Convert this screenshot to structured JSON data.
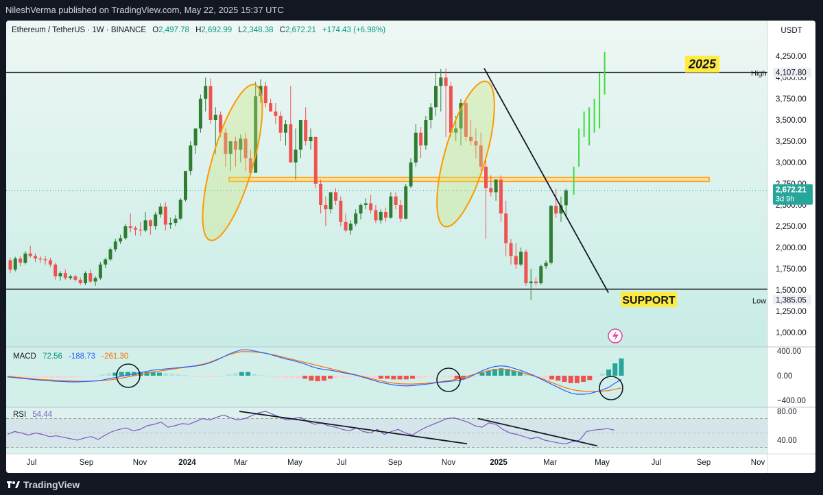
{
  "header": {
    "published": "NileshVerma published on TradingView.com, May 22, 2025 15:37 UTC"
  },
  "footer": {
    "brand": "TradingView"
  },
  "symbol": {
    "title": "Ethereum / TetherUS · 1W · BINANCE",
    "open_label": "O",
    "open": "2,497.78",
    "high_label": "H",
    "high": "2,692.99",
    "low_label": "L",
    "low": "2,348.38",
    "close_label": "C",
    "close": "2,672.21",
    "change": "+174.43 (+6.98%)"
  },
  "price_axis": {
    "currency": "USDT",
    "ticks": [
      "4,250.00",
      "4,000.00",
      "3,750.00",
      "3,500.00",
      "3,250.00",
      "3,000.00",
      "2,750.00",
      "2,500.00",
      "2,250.00",
      "2,000.00",
      "1,750.00",
      "1,500.00",
      "1,250.00",
      "1,000.00"
    ],
    "tick_values": [
      4250,
      4000,
      3750,
      3500,
      3250,
      3000,
      2750,
      2500,
      2250,
      2000,
      1750,
      1500,
      1250,
      1000
    ],
    "high_label": "High",
    "high_value": "4,107.80",
    "low_label": "Low",
    "low_value": "1,385.05",
    "last_price": "2,672.21",
    "countdown": "3d 9h"
  },
  "annotations": {
    "year_label": "2025",
    "support_label": "SUPPORT"
  },
  "macd": {
    "label": "MACD",
    "v1": "72.56",
    "v2": "-188.73",
    "v3": "-261.30",
    "ticks": [
      "400.00",
      "0.00",
      "−400.00"
    ]
  },
  "rsi": {
    "label": "RSI",
    "value": "54.44",
    "ticks": [
      "80.00",
      "40.00"
    ]
  },
  "time_axis": {
    "labels": [
      {
        "text": "Jul",
        "bold": false
      },
      {
        "text": "Sep",
        "bold": false
      },
      {
        "text": "Nov",
        "bold": false
      },
      {
        "text": "2024",
        "bold": true
      },
      {
        "text": "Mar",
        "bold": false
      },
      {
        "text": "May",
        "bold": false
      },
      {
        "text": "Jul",
        "bold": false
      },
      {
        "text": "Sep",
        "bold": false
      },
      {
        "text": "Nov",
        "bold": false
      },
      {
        "text": "2025",
        "bold": true
      },
      {
        "text": "Mar",
        "bold": false
      },
      {
        "text": "May",
        "bold": false
      },
      {
        "text": "Jul",
        "bold": false
      },
      {
        "text": "Sep",
        "bold": false
      },
      {
        "text": "Nov",
        "bold": false
      }
    ]
  },
  "colors": {
    "up": "#26a69a",
    "down": "#ef5350",
    "up_dark": "#2e7d32",
    "macd_line": "#2962ff",
    "signal_line": "#ff6d00",
    "rsi_line": "#7e57c2",
    "zone": "#ff9800",
    "background_tint": "#cdeee8"
  },
  "chart_data": {
    "type": "candlestick",
    "timeframe": "1W",
    "candles_ohlc_approx": [
      [
        1850,
        1880,
        1700,
        1740
      ],
      [
        1740,
        1890,
        1720,
        1870
      ],
      [
        1870,
        1900,
        1780,
        1820
      ],
      [
        1820,
        1960,
        1800,
        1930
      ],
      [
        1930,
        2020,
        1880,
        1900
      ],
      [
        1900,
        1930,
        1830,
        1870
      ],
      [
        1870,
        1900,
        1820,
        1860
      ],
      [
        1860,
        1900,
        1800,
        1850
      ],
      [
        1850,
        1880,
        1770,
        1800
      ],
      [
        1800,
        1820,
        1620,
        1660
      ],
      [
        1660,
        1720,
        1610,
        1700
      ],
      [
        1700,
        1740,
        1620,
        1640
      ],
      [
        1640,
        1680,
        1620,
        1660
      ],
      [
        1660,
        1680,
        1600,
        1620
      ],
      [
        1620,
        1650,
        1560,
        1580
      ],
      [
        1580,
        1720,
        1560,
        1700
      ],
      [
        1700,
        1740,
        1580,
        1600
      ],
      [
        1600,
        1660,
        1550,
        1640
      ],
      [
        1640,
        1830,
        1620,
        1800
      ],
      [
        1800,
        1880,
        1760,
        1860
      ],
      [
        1860,
        2000,
        1840,
        1980
      ],
      [
        1980,
        2100,
        1950,
        2070
      ],
      [
        2070,
        2150,
        2040,
        2110
      ],
      [
        2110,
        2280,
        2090,
        2250
      ],
      [
        2250,
        2400,
        2180,
        2230
      ],
      [
        2230,
        2250,
        2140,
        2210
      ],
      [
        2210,
        2300,
        2140,
        2200
      ],
      [
        2200,
        2420,
        2180,
        2320
      ],
      [
        2320,
        2330,
        2150,
        2250
      ],
      [
        2250,
        2420,
        2210,
        2390
      ],
      [
        2390,
        2520,
        2350,
        2480
      ],
      [
        2480,
        2530,
        2200,
        2270
      ],
      [
        2270,
        2350,
        2220,
        2290
      ],
      [
        2290,
        2380,
        2250,
        2340
      ],
      [
        2340,
        2580,
        2320,
        2560
      ],
      [
        2560,
        2850,
        2540,
        2900
      ],
      [
        2900,
        3250,
        2850,
        3200
      ],
      [
        3200,
        3400,
        3100,
        3400
      ],
      [
        3400,
        3800,
        3350,
        3750
      ],
      [
        3750,
        4000,
        3600,
        3900
      ],
      [
        3900,
        3990,
        3450,
        3500
      ],
      [
        3500,
        3650,
        3100,
        3560
      ],
      [
        3560,
        3600,
        3300,
        3350
      ],
      [
        3350,
        3400,
        2950,
        3100
      ],
      [
        3100,
        3250,
        2900,
        3250
      ],
      [
        3250,
        3300,
        2950,
        3150
      ],
      [
        3150,
        3330,
        3000,
        3280
      ],
      [
        3280,
        3350,
        2900,
        3050
      ],
      [
        3050,
        3150,
        2850,
        2880
      ],
      [
        2880,
        3950,
        2880,
        3780
      ],
      [
        3780,
        3980,
        3700,
        3900
      ],
      [
        3900,
        3950,
        3650,
        3700
      ],
      [
        3700,
        3750,
        3600,
        3600
      ],
      [
        3600,
        3700,
        3450,
        3550
      ],
      [
        3550,
        3600,
        3250,
        3350
      ],
      [
        3350,
        3500,
        3200,
        3450
      ],
      [
        3450,
        3900,
        3300,
        3000
      ],
      [
        3000,
        3400,
        2800,
        3150
      ],
      [
        3150,
        3500,
        3050,
        3500
      ],
      [
        3500,
        3650,
        3200,
        3250
      ],
      [
        3250,
        3400,
        3150,
        3300
      ],
      [
        3300,
        3250,
        2700,
        2750
      ],
      [
        2750,
        2800,
        2400,
        2500
      ],
      [
        2500,
        2600,
        2250,
        2450
      ],
      [
        2450,
        2650,
        2400,
        2650
      ],
      [
        2650,
        2700,
        2500,
        2550
      ],
      [
        2550,
        2600,
        2250,
        2300
      ],
      [
        2300,
        2400,
        2180,
        2200
      ],
      [
        2200,
        2320,
        2150,
        2280
      ],
      [
        2280,
        2450,
        2250,
        2400
      ],
      [
        2400,
        2520,
        2330,
        2500
      ],
      [
        2500,
        2580,
        2450,
        2520
      ],
      [
        2520,
        2620,
        2400,
        2440
      ],
      [
        2440,
        2500,
        2290,
        2320
      ],
      [
        2320,
        2450,
        2280,
        2420
      ],
      [
        2420,
        2470,
        2300,
        2350
      ],
      [
        2350,
        2650,
        2340,
        2600
      ],
      [
        2600,
        2650,
        2450,
        2500
      ],
      [
        2500,
        2560,
        2300,
        2340
      ],
      [
        2340,
        2750,
        2330,
        2720
      ],
      [
        2720,
        3050,
        2700,
        3000
      ],
      [
        3000,
        3450,
        2950,
        3350
      ],
      [
        3350,
        3420,
        3050,
        3200
      ],
      [
        3200,
        3550,
        3150,
        3500
      ],
      [
        3500,
        3700,
        3400,
        3650
      ],
      [
        3650,
        4050,
        3550,
        3900
      ],
      [
        3900,
        4100,
        3600,
        4000
      ],
      [
        4000,
        4107,
        3300,
        3900
      ],
      [
        3900,
        3950,
        3300,
        3350
      ],
      [
        3350,
        3550,
        3250,
        3400
      ],
      [
        3400,
        3750,
        3200,
        3700
      ],
      [
        3700,
        3740,
        3250,
        3300
      ],
      [
        3300,
        3500,
        3200,
        3250
      ],
      [
        3250,
        3400,
        3050,
        3200
      ],
      [
        3200,
        3350,
        2900,
        2950
      ],
      [
        2950,
        3050,
        2100,
        2700
      ],
      [
        2700,
        2850,
        2600,
        2650
      ],
      [
        2650,
        2800,
        2550,
        2800
      ],
      [
        2800,
        2850,
        2300,
        2400
      ],
      [
        2400,
        2550,
        1900,
        2050
      ],
      [
        2050,
        2100,
        1800,
        1900
      ],
      [
        1900,
        2050,
        1750,
        1800
      ],
      [
        1800,
        2000,
        1780,
        1950
      ],
      [
        1950,
        1980,
        1550,
        1580
      ],
      [
        1580,
        1750,
        1385,
        1600
      ],
      [
        1600,
        1650,
        1550,
        1580
      ],
      [
        1580,
        1800,
        1560,
        1780
      ],
      [
        1780,
        1850,
        1750,
        1820
      ],
      [
        1820,
        2500,
        1800,
        2490
      ],
      [
        2490,
        2692,
        2348,
        2400
      ],
      [
        2400,
        2600,
        2300,
        2497
      ],
      [
        2497.78,
        2692.99,
        2348.38,
        2672.21
      ]
    ],
    "projection_bars": [
      [
        2620,
        2950
      ],
      [
        2950,
        3400
      ],
      [
        3300,
        3600
      ],
      [
        3200,
        3650
      ],
      [
        3350,
        3750
      ],
      [
        3400,
        4050
      ],
      [
        3800,
        4300
      ]
    ],
    "levels": {
      "resistance": 4060,
      "support": 1510,
      "zone_low": 2780,
      "zone_high": 2810
    },
    "macd_line": [
      -20,
      -30,
      -40,
      -50,
      -60,
      -70,
      -80,
      -85,
      -90,
      -95,
      -100,
      -100,
      -95,
      -90,
      -85,
      -70,
      -50,
      -30,
      -10,
      10,
      30,
      50,
      70,
      90,
      100,
      110,
      120,
      130,
      140,
      150,
      160,
      180,
      210,
      250,
      300,
      350,
      390,
      420,
      420,
      400,
      380,
      360,
      330,
      300,
      270,
      250,
      220,
      190,
      150,
      120,
      100,
      90,
      70,
      50,
      30,
      10,
      -20,
      -50,
      -80,
      -110,
      -130,
      -150,
      -160,
      -165,
      -160,
      -150,
      -140,
      -125,
      -110,
      -100,
      -90,
      -80,
      -60,
      -20,
      30,
      80,
      120,
      150,
      160,
      150,
      120,
      90,
      50,
      10,
      -40,
      -90,
      -140,
      -190,
      -240,
      -280,
      -300,
      -300,
      -290,
      -260,
      -230,
      -190,
      -120,
      -60
    ],
    "signal_line": [
      -10,
      -20,
      -30,
      -40,
      -50,
      -60,
      -65,
      -70,
      -75,
      -80,
      -85,
      -90,
      -90,
      -88,
      -85,
      -80,
      -70,
      -55,
      -40,
      -20,
      0,
      20,
      40,
      60,
      75,
      90,
      105,
      120,
      135,
      150,
      170,
      190,
      220,
      260,
      300,
      340,
      370,
      390,
      390,
      385,
      375,
      360,
      340,
      315,
      290,
      265,
      240,
      215,
      190,
      165,
      140,
      115,
      90,
      65,
      40,
      15,
      -10,
      -35,
      -60,
      -85,
      -105,
      -120,
      -130,
      -135,
      -135,
      -130,
      -125,
      -115,
      -105,
      -90,
      -75,
      -55,
      -30,
      0,
      30,
      55,
      80,
      95,
      100,
      95,
      80,
      60,
      30,
      0,
      -30,
      -70,
      -110,
      -150,
      -190,
      -220,
      -240,
      -250,
      -255,
      -255,
      -250,
      -240,
      -220,
      -200
    ],
    "rsi_line": [
      48,
      52,
      50,
      47,
      50,
      48,
      45,
      46,
      44,
      42,
      40,
      43,
      45,
      41,
      47,
      52,
      55,
      57,
      53,
      55,
      60,
      62,
      65,
      58,
      60,
      63,
      62,
      66,
      70,
      68,
      72,
      75,
      71,
      68,
      70,
      74,
      78,
      80,
      76,
      72,
      68,
      70,
      72,
      66,
      62,
      64,
      60,
      58,
      55,
      53,
      57,
      52,
      50,
      55,
      48,
      52,
      55,
      50,
      47,
      53,
      58,
      62,
      66,
      70,
      71,
      68,
      65,
      60,
      58,
      64,
      62,
      55,
      50,
      48,
      45,
      42,
      44,
      40,
      38,
      36,
      35,
      38,
      40,
      52,
      54,
      55,
      56,
      54
    ]
  }
}
